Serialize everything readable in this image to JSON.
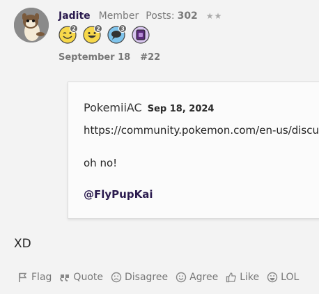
{
  "post": {
    "author": "Jadite",
    "role": "Member",
    "posts_label": "Posts:",
    "posts_count": "302",
    "stars": "★★",
    "badges": [
      {
        "icon": "winking-emoji-badge-icon",
        "count": "2"
      },
      {
        "icon": "grinning-emoji-badge-icon",
        "count": "2"
      },
      {
        "icon": "speech-bubble-badge-icon",
        "count": "3"
      },
      {
        "icon": "purple-card-badge-icon"
      }
    ],
    "date": "September 18",
    "number": "#22"
  },
  "quote": {
    "author": "PokemiiAC",
    "date": "Sep 18, 2024",
    "link": "https://community.pokemon.com/en-us/discus",
    "text": "oh no!",
    "mention": "@FlyPupKai"
  },
  "reply": {
    "text": "XD"
  },
  "actions": [
    {
      "label": "Flag",
      "icon": "flag-icon"
    },
    {
      "label": "Quote",
      "icon": "quote-icon"
    },
    {
      "label": "Disagree",
      "icon": "frown-face-icon"
    },
    {
      "label": "Agree",
      "icon": "smile-face-icon"
    },
    {
      "label": "Like",
      "icon": "thumbs-up-icon"
    },
    {
      "label": "LOL",
      "icon": "laugh-face-icon"
    }
  ],
  "colors": {
    "background": "#f3f3f3",
    "username": "#2a1a4e",
    "muted": "#777777",
    "quote_bg": "#fbfbfb"
  }
}
